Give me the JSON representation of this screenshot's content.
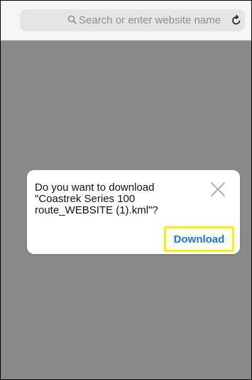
{
  "browser": {
    "address_placeholder": "Search or enter website name",
    "search_icon": "search-icon",
    "reload_icon": "reload-icon"
  },
  "dialog": {
    "line1": "Do you want to download",
    "line2": "\"Coastrek Series 100",
    "line3": "route_WEBSITE (1).kml\"?",
    "close_icon": "close-icon",
    "download_label": "Download"
  },
  "colors": {
    "overlay": "#8a8a8a",
    "accent": "#1a73e8",
    "highlight": "#f5f500"
  }
}
